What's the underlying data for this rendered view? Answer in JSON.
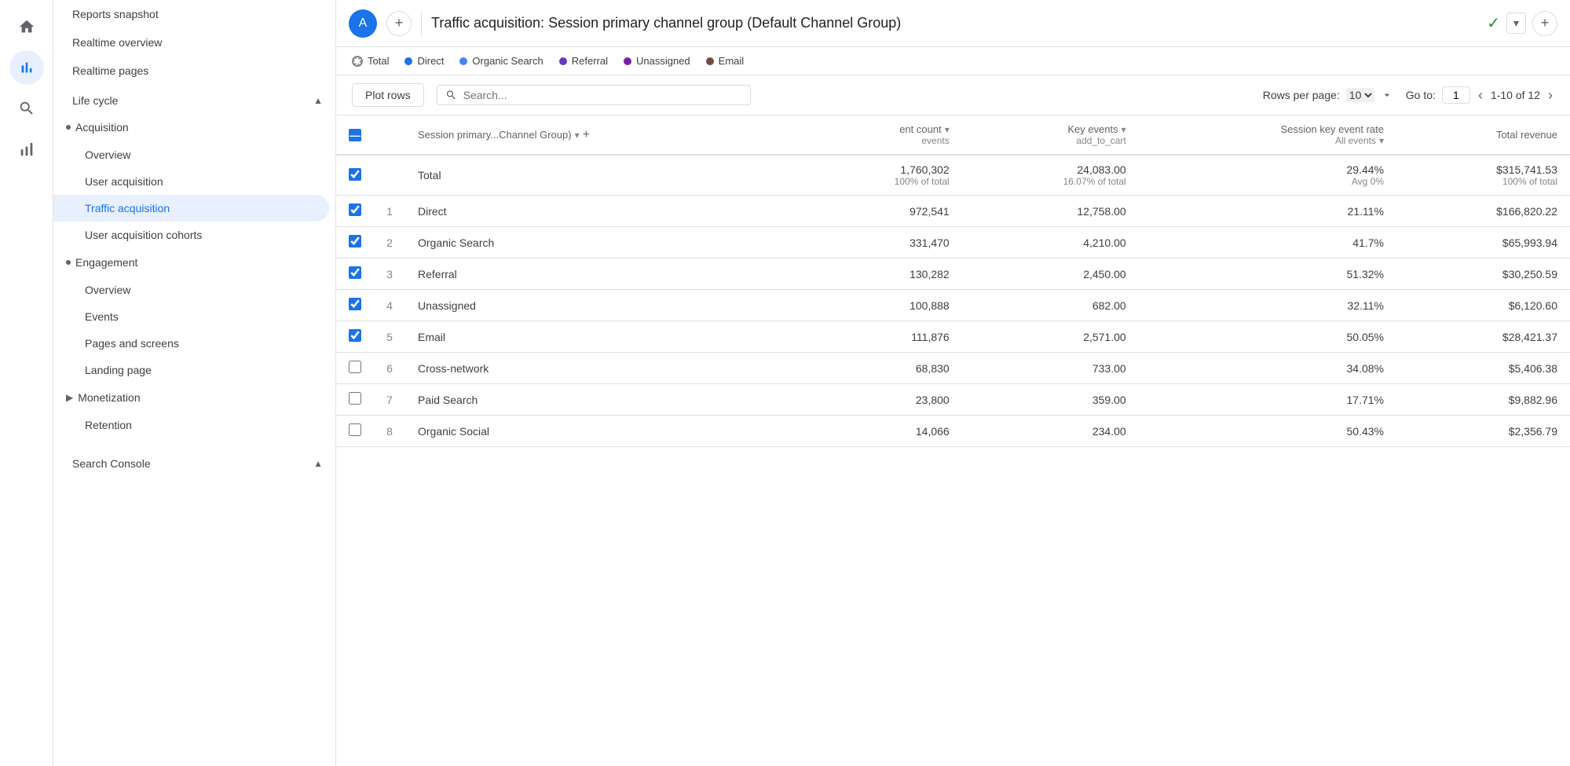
{
  "iconBar": {
    "items": [
      {
        "id": "home",
        "icon": "home",
        "active": false
      },
      {
        "id": "analytics",
        "icon": "analytics",
        "active": true
      },
      {
        "id": "search",
        "icon": "search_insights",
        "active": false
      },
      {
        "id": "advertising",
        "icon": "advertising",
        "active": false
      }
    ]
  },
  "sidebar": {
    "topItems": [
      {
        "id": "reports-snapshot",
        "label": "Reports snapshot",
        "active": false
      },
      {
        "id": "realtime-overview",
        "label": "Realtime overview",
        "active": false
      },
      {
        "id": "realtime-pages",
        "label": "Realtime pages",
        "active": false
      }
    ],
    "sections": [
      {
        "id": "lifecycle",
        "label": "Life cycle",
        "expanded": true,
        "groups": [
          {
            "id": "acquisition",
            "label": "Acquisition",
            "expanded": true,
            "children": [
              {
                "id": "overview",
                "label": "Overview",
                "active": false
              },
              {
                "id": "user-acquisition",
                "label": "User acquisition",
                "active": false
              },
              {
                "id": "traffic-acquisition",
                "label": "Traffic acquisition",
                "active": true
              },
              {
                "id": "user-acquisition-cohorts",
                "label": "User acquisition cohorts",
                "active": false
              }
            ]
          },
          {
            "id": "engagement",
            "label": "Engagement",
            "expanded": true,
            "children": [
              {
                "id": "eng-overview",
                "label": "Overview",
                "active": false
              },
              {
                "id": "events",
                "label": "Events",
                "active": false
              },
              {
                "id": "pages-and-screens",
                "label": "Pages and screens",
                "active": false
              },
              {
                "id": "landing-page",
                "label": "Landing page",
                "active": false
              }
            ]
          },
          {
            "id": "monetization",
            "label": "Monetization",
            "expanded": false,
            "children": []
          },
          {
            "id": "retention",
            "label": "Retention",
            "expanded": false,
            "children": []
          }
        ]
      },
      {
        "id": "search-console",
        "label": "Search Console",
        "expanded": true
      }
    ]
  },
  "header": {
    "avatar": "A",
    "title": "Traffic acquisition: Session primary channel group (Default Channel Group)",
    "addTabLabel": "+",
    "checkIcon": "✓"
  },
  "legend": {
    "items": [
      {
        "id": "total",
        "label": "Total",
        "color": "total",
        "type": "circle-outline"
      },
      {
        "id": "direct",
        "label": "Direct",
        "color": "#1a73e8"
      },
      {
        "id": "organic-search",
        "label": "Organic Search",
        "color": "#4285f4"
      },
      {
        "id": "referral",
        "label": "Referral",
        "color": "#673ab7"
      },
      {
        "id": "unassigned",
        "label": "Unassigned",
        "color": "#7b1fa2"
      },
      {
        "id": "email",
        "label": "Email",
        "color": "#6d4c41"
      }
    ]
  },
  "tableControls": {
    "plotRowsLabel": "Plot rows",
    "searchPlaceholder": "Search...",
    "rowsPerPageLabel": "Rows per page:",
    "rowsPerPageValue": "10",
    "goToLabel": "Go to:",
    "goToValue": "1",
    "paginationText": "1-10 of 12"
  },
  "tableHeader": {
    "dimensionLabel": "Session primary...Channel Group)",
    "col1Label": "ent count",
    "col1Sub": "events",
    "col2Label": "Key events",
    "col2Sub": "add_to_cart",
    "col3Label": "Session key event rate",
    "col3Sub": "All events",
    "col4Label": "Total revenue"
  },
  "tableRows": [
    {
      "id": "total",
      "isTotal": true,
      "checked": true,
      "num": "",
      "name": "Total",
      "col1": "1,760,302",
      "col1Sub": "100% of total",
      "col2": "24,083.00",
      "col2Sub": "16.07% of total",
      "col3": "29.44%",
      "col3Sub": "Avg 0%",
      "col4": "$315,741.53",
      "col4Sub": "100% of total"
    },
    {
      "id": "row1",
      "isTotal": false,
      "checked": true,
      "num": "1",
      "name": "Direct",
      "col1": "972,541",
      "col1Sub": "",
      "col2": "12,758.00",
      "col2Sub": "",
      "col3": "21.11%",
      "col3Sub": "",
      "col4": "$166,820.22",
      "col4Sub": ""
    },
    {
      "id": "row2",
      "isTotal": false,
      "checked": true,
      "num": "2",
      "name": "Organic Search",
      "col1": "331,470",
      "col1Sub": "",
      "col2": "4,210.00",
      "col2Sub": "",
      "col3": "41.7%",
      "col3Sub": "",
      "col4": "$65,993.94",
      "col4Sub": ""
    },
    {
      "id": "row3",
      "isTotal": false,
      "checked": true,
      "num": "3",
      "name": "Referral",
      "col1": "130,282",
      "col1Sub": "",
      "col2": "2,450.00",
      "col2Sub": "",
      "col3": "51.32%",
      "col3Sub": "",
      "col4": "$30,250.59",
      "col4Sub": ""
    },
    {
      "id": "row4",
      "isTotal": false,
      "checked": true,
      "num": "4",
      "name": "Unassigned",
      "col1": "100,888",
      "col1Sub": "",
      "col2": "682.00",
      "col2Sub": "",
      "col3": "32.11%",
      "col3Sub": "",
      "col4": "$6,120.60",
      "col4Sub": ""
    },
    {
      "id": "row5",
      "isTotal": false,
      "checked": true,
      "num": "5",
      "name": "Email",
      "col1": "111,876",
      "col1Sub": "",
      "col2": "2,571.00",
      "col2Sub": "",
      "col3": "50.05%",
      "col3Sub": "",
      "col4": "$28,421.37",
      "col4Sub": ""
    },
    {
      "id": "row6",
      "isTotal": false,
      "checked": false,
      "num": "6",
      "name": "Cross-network",
      "col1": "68,830",
      "col1Sub": "",
      "col2": "733.00",
      "col2Sub": "",
      "col3": "34.08%",
      "col3Sub": "",
      "col4": "$5,406.38",
      "col4Sub": ""
    },
    {
      "id": "row7",
      "isTotal": false,
      "checked": false,
      "num": "7",
      "name": "Paid Search",
      "col1": "23,800",
      "col1Sub": "",
      "col2": "359.00",
      "col2Sub": "",
      "col3": "17.71%",
      "col3Sub": "",
      "col4": "$9,882.96",
      "col4Sub": ""
    },
    {
      "id": "row8",
      "isTotal": false,
      "checked": false,
      "num": "8",
      "name": "Organic Social",
      "col1": "14,066",
      "col1Sub": "",
      "col2": "234.00",
      "col2Sub": "",
      "col3": "50.43%",
      "col3Sub": "",
      "col4": "$2,356.79",
      "col4Sub": ""
    }
  ],
  "colors": {
    "blue": "#1a73e8",
    "lightBlue": "#e8f0fe",
    "border": "#e0e0e0",
    "text": "#3c4043",
    "subText": "#5f6368",
    "accent": "#1a73e8"
  }
}
